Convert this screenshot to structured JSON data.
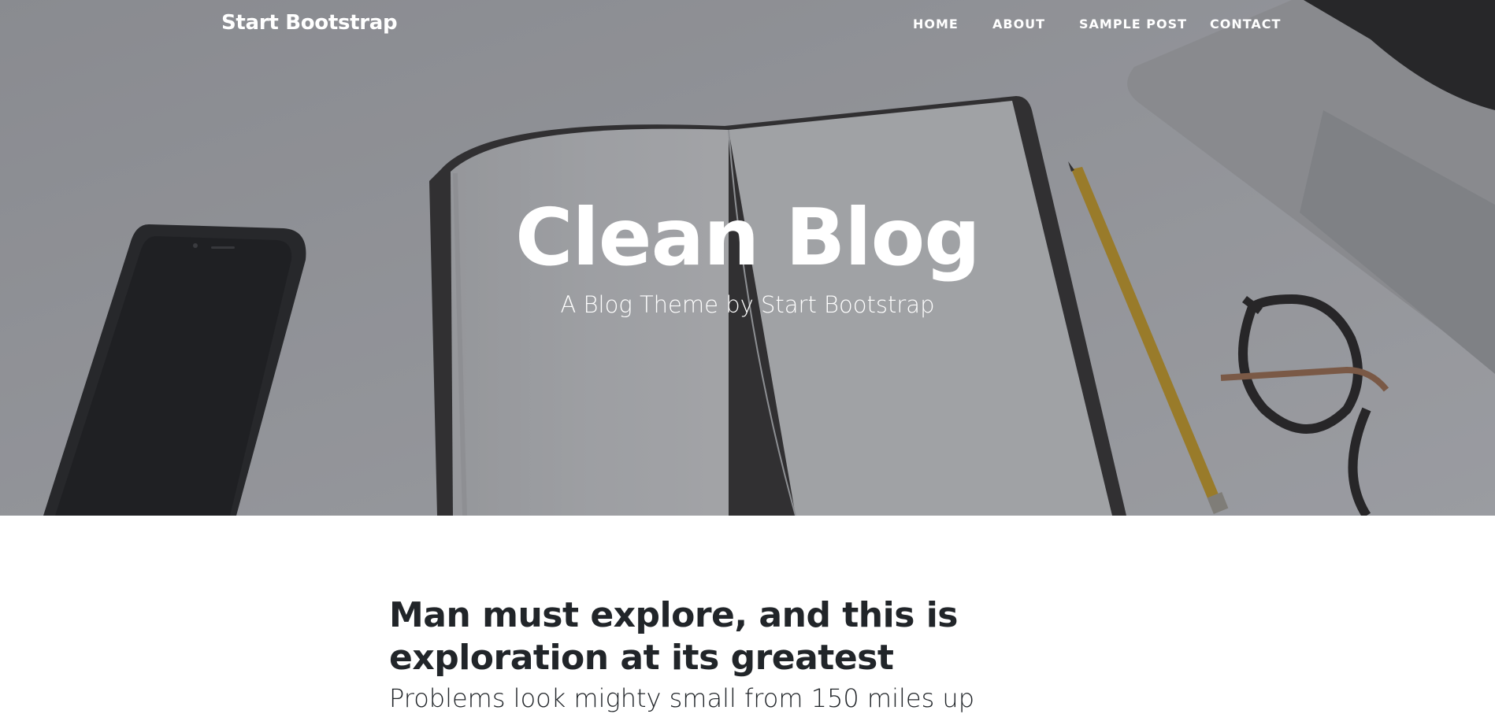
{
  "navbar": {
    "brand": "Start Bootstrap",
    "items": [
      {
        "label": "HOME"
      },
      {
        "label": "ABOUT"
      },
      {
        "label": "SAMPLE POST"
      },
      {
        "label": "CONTACT"
      }
    ]
  },
  "masthead": {
    "title": "Clean Blog",
    "subtitle": "A Blog Theme by Start Bootstrap",
    "background_image": "desk-with-notebook-phone-pencil-glasses-laptop"
  },
  "post_preview": {
    "title": "Man must explore, and this is exploration at its greatest",
    "subtitle": "Problems look mighty small from 150 miles up"
  },
  "colors": {
    "text_dark": "#212529",
    "white": "#ffffff",
    "overlay": "#212529"
  }
}
